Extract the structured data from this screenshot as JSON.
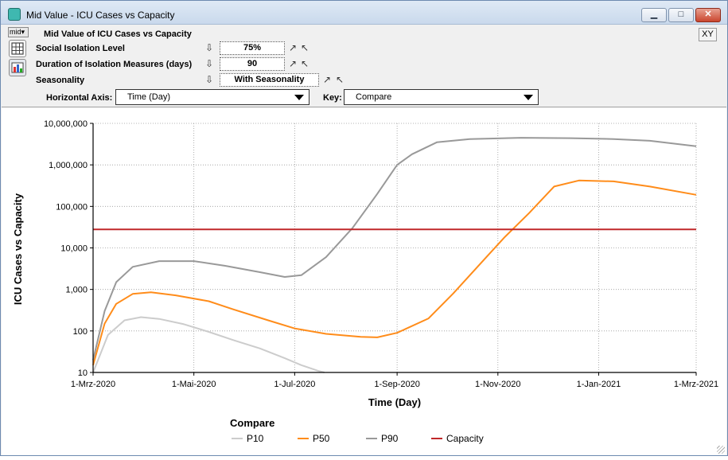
{
  "window": {
    "title": "Mid Value - ICU Cases vs Capacity",
    "minimize_label": "▁",
    "maximize_label": "□",
    "close_label": "✕",
    "icon": "model-icon"
  },
  "panel": {
    "mode_label": "mid",
    "heading": "Mid Value of ICU Cases vs Capacity",
    "xy_label": "XY",
    "inputs": [
      {
        "label": "Social Isolation Level",
        "value": "75%"
      },
      {
        "label": "Duration of Isolation Measures   (days)",
        "value": "90"
      },
      {
        "label": "Seasonality",
        "value": "With Seasonality"
      }
    ],
    "horizontal_axis_label": "Horizontal Axis:",
    "horizontal_axis_value": "Time (Day)",
    "key_label": "Key:",
    "key_value": "Compare"
  },
  "colors": {
    "P10": "#cccccc",
    "P50": "#ff8c1a",
    "P90": "#999999",
    "Capacity": "#c0282a"
  },
  "chart_data": {
    "type": "line",
    "title": "",
    "xlabel": "Time (Day)",
    "ylabel": "ICU Cases vs Capacity",
    "yscale": "log",
    "ylim": [
      10,
      10000000
    ],
    "xlim": [
      "2020-03-01",
      "2021-03-01"
    ],
    "x_tick_labels": [
      "1-Mrz-2020",
      "1-Mai-2020",
      "1-Jul-2020",
      "1-Sep-2020",
      "1-Nov-2020",
      "1-Jan-2021",
      "1-Mrz-2021"
    ],
    "x_tick_dates": [
      "2020-03-01",
      "2020-05-01",
      "2020-07-01",
      "2020-09-01",
      "2020-11-01",
      "2021-01-01",
      "2021-03-01"
    ],
    "y_tick_labels": [
      "10",
      "100",
      "1,000",
      "10,000",
      "100,000",
      "1,000,000",
      "10,000,000"
    ],
    "y_ticks": [
      10,
      100,
      1000,
      10000,
      100000,
      1000000,
      10000000
    ],
    "grid": true,
    "legend": {
      "title": "Compare",
      "placement": "bottom"
    },
    "series": [
      {
        "name": "P10",
        "points": [
          [
            "2020-03-01",
            10
          ],
          [
            "2020-03-10",
            80
          ],
          [
            "2020-03-20",
            180
          ],
          [
            "2020-03-30",
            215
          ],
          [
            "2020-04-10",
            195
          ],
          [
            "2020-04-25",
            145
          ],
          [
            "2020-05-10",
            95
          ],
          [
            "2020-05-25",
            60
          ],
          [
            "2020-06-10",
            38
          ],
          [
            "2020-06-25",
            22
          ],
          [
            "2020-07-05",
            15
          ],
          [
            "2020-07-15",
            11
          ],
          [
            "2020-07-19",
            10
          ]
        ]
      },
      {
        "name": "P50",
        "points": [
          [
            "2020-03-01",
            15
          ],
          [
            "2020-03-08",
            150
          ],
          [
            "2020-03-15",
            450
          ],
          [
            "2020-03-25",
            780
          ],
          [
            "2020-04-05",
            850
          ],
          [
            "2020-04-20",
            720
          ],
          [
            "2020-05-10",
            520
          ],
          [
            "2020-05-25",
            330
          ],
          [
            "2020-06-15",
            180
          ],
          [
            "2020-07-01",
            115
          ],
          [
            "2020-07-20",
            85
          ],
          [
            "2020-08-10",
            72
          ],
          [
            "2020-08-20",
            70
          ],
          [
            "2020-09-01",
            90
          ],
          [
            "2020-09-20",
            200
          ],
          [
            "2020-10-05",
            800
          ],
          [
            "2020-10-25",
            6000
          ],
          [
            "2020-11-05",
            18000
          ],
          [
            "2020-11-20",
            70000
          ],
          [
            "2020-12-05",
            300000
          ],
          [
            "2020-12-20",
            420000
          ],
          [
            "2021-01-10",
            400000
          ],
          [
            "2021-02-01",
            300000
          ],
          [
            "2021-03-01",
            190000
          ]
        ]
      },
      {
        "name": "P90",
        "points": [
          [
            "2020-03-01",
            20
          ],
          [
            "2020-03-08",
            300
          ],
          [
            "2020-03-15",
            1500
          ],
          [
            "2020-03-25",
            3500
          ],
          [
            "2020-04-10",
            4800
          ],
          [
            "2020-05-01",
            4800
          ],
          [
            "2020-05-20",
            3700
          ],
          [
            "2020-06-10",
            2600
          ],
          [
            "2020-06-25",
            2000
          ],
          [
            "2020-07-05",
            2200
          ],
          [
            "2020-07-20",
            6000
          ],
          [
            "2020-08-05",
            30000
          ],
          [
            "2020-08-20",
            200000
          ],
          [
            "2020-09-01",
            1000000
          ],
          [
            "2020-09-10",
            1800000
          ],
          [
            "2020-09-25",
            3500000
          ],
          [
            "2020-10-15",
            4200000
          ],
          [
            "2020-11-15",
            4500000
          ],
          [
            "2020-12-15",
            4400000
          ],
          [
            "2021-01-10",
            4200000
          ],
          [
            "2021-02-01",
            3800000
          ],
          [
            "2021-03-01",
            2800000
          ]
        ]
      },
      {
        "name": "Capacity",
        "points": [
          [
            "2020-03-01",
            28000
          ],
          [
            "2021-03-01",
            28000
          ]
        ]
      }
    ]
  }
}
